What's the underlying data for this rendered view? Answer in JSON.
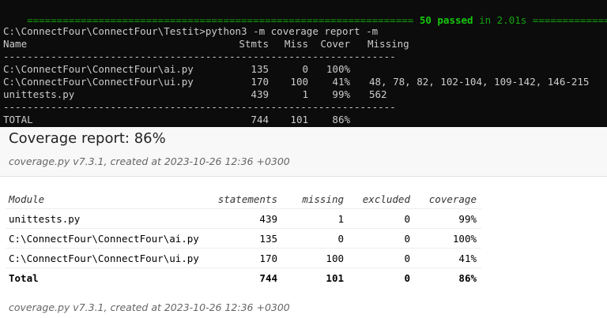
{
  "terminal": {
    "pass_bar": {
      "left": "=================================================================",
      "passed": "50 passed",
      "time": " in 2.01s",
      "right": " =============================="
    },
    "prompt": "C:\\ConnectFour\\ConnectFour\\Testit>python3 -m coverage report -m",
    "headers": {
      "name": "Name",
      "stmts": "Stmts",
      "miss": "Miss",
      "cover": "Cover",
      "missing": "Missing"
    },
    "separator": "------------------------------------------------------------------",
    "rows": [
      {
        "name": "C:\\ConnectFour\\ConnectFour\\ai.py",
        "stmts": "135",
        "miss": "0",
        "cover": "100%",
        "missing": ""
      },
      {
        "name": "C:\\ConnectFour\\ConnectFour\\ui.py",
        "stmts": "170",
        "miss": "100",
        "cover": "41%",
        "missing": "48, 78, 82, 102-104, 109-142, 146-215"
      },
      {
        "name": "unittests.py",
        "stmts": "439",
        "miss": "1",
        "cover": "99%",
        "missing": "562"
      }
    ],
    "total": {
      "name": "TOTAL",
      "stmts": "744",
      "miss": "101",
      "cover": "86%"
    }
  },
  "report": {
    "title": "Coverage report: 86%",
    "meta": "coverage.py v7.3.1, created at 2023-10-26 12:36 +0300"
  },
  "table": {
    "headers": {
      "module": "Module",
      "statements": "statements",
      "missing": "missing",
      "excluded": "excluded",
      "coverage": "coverage"
    },
    "rows": [
      {
        "module": "unittests.py",
        "statements": "439",
        "missing": "1",
        "excluded": "0",
        "coverage": "99%"
      },
      {
        "module": "C:\\ConnectFour\\ConnectFour\\ai.py",
        "statements": "135",
        "missing": "0",
        "excluded": "0",
        "coverage": "100%"
      },
      {
        "module": "C:\\ConnectFour\\ConnectFour\\ui.py",
        "statements": "170",
        "missing": "100",
        "excluded": "0",
        "coverage": "41%"
      }
    ],
    "total": {
      "module": "Total",
      "statements": "744",
      "missing": "101",
      "excluded": "0",
      "coverage": "86%"
    }
  },
  "footer": {
    "meta": "coverage.py v7.3.1, created at 2023-10-26 12:36 +0300"
  }
}
